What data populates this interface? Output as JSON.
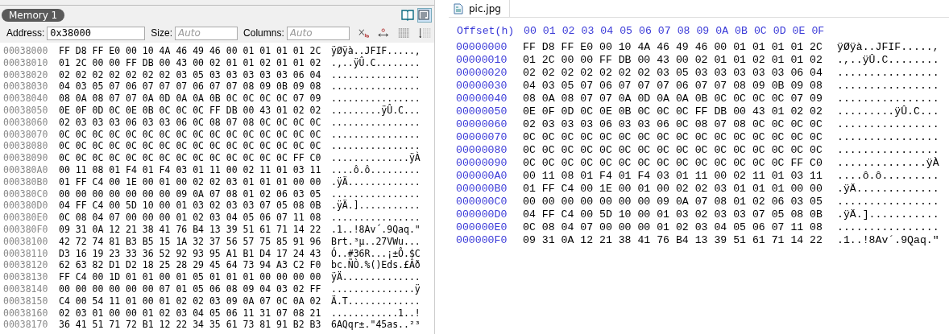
{
  "memory_panel": {
    "tab": "Memory 1",
    "address_label": "Address:",
    "address_value": "0x38000",
    "size_label": "Size:",
    "size_placeholder": "Auto",
    "columns_label": "Columns:",
    "columns_placeholder": "Auto",
    "rows": [
      {
        "address": "00038000",
        "hex": "FF D8 FF E0 00 10 4A 46 49 46 00 01 01 01 01 2C",
        "ascii": "ÿØÿà..JFIF.....,"
      },
      {
        "address": "00038010",
        "hex": "01 2C 00 00 FF DB 00 43 00 02 01 01 02 01 01 02",
        "ascii": ".,..ÿÛ.C........"
      },
      {
        "address": "00038020",
        "hex": "02 02 02 02 02 02 02 03 05 03 03 03 03 03 06 04",
        "ascii": "................"
      },
      {
        "address": "00038030",
        "hex": "04 03 05 07 06 07 07 07 06 07 07 08 09 0B 09 08",
        "ascii": "................"
      },
      {
        "address": "00038040",
        "hex": "08 0A 08 07 07 0A 0D 0A 0A 0B 0C 0C 0C 0C 07 09",
        "ascii": "................"
      },
      {
        "address": "00038050",
        "hex": "0E 0F 0D 0C 0E 0B 0C 0C 0C FF DB 00 43 01 02 02",
        "ascii": ".........ÿÛ.C..."
      },
      {
        "address": "00038060",
        "hex": "02 03 03 03 06 03 03 06 0C 08 07 08 0C 0C 0C 0C",
        "ascii": "................"
      },
      {
        "address": "00038070",
        "hex": "0C 0C 0C 0C 0C 0C 0C 0C 0C 0C 0C 0C 0C 0C 0C 0C",
        "ascii": "................"
      },
      {
        "address": "00038080",
        "hex": "0C 0C 0C 0C 0C 0C 0C 0C 0C 0C 0C 0C 0C 0C 0C 0C",
        "ascii": "................"
      },
      {
        "address": "00038090",
        "hex": "0C 0C 0C 0C 0C 0C 0C 0C 0C 0C 0C 0C 0C 0C FF C0",
        "ascii": "..............ÿÀ"
      },
      {
        "address": "000380A0",
        "hex": "00 11 08 01 F4 01 F4 03 01 11 00 02 11 01 03 11",
        "ascii": "....ô.ô........."
      },
      {
        "address": "000380B0",
        "hex": "01 FF C4 00 1E 00 01 00 02 02 03 01 01 01 00 00",
        "ascii": ".ÿÄ............."
      },
      {
        "address": "000380C0",
        "hex": "00 00 00 00 00 00 00 09 0A 07 08 01 02 06 03 05",
        "ascii": "................"
      },
      {
        "address": "000380D0",
        "hex": "04 FF C4 00 5D 10 00 01 03 02 03 03 07 05 08 0B",
        "ascii": ".ÿÄ.]..........."
      },
      {
        "address": "000380E0",
        "hex": "0C 08 04 07 00 00 00 01 02 03 04 05 06 07 11 08",
        "ascii": "................"
      },
      {
        "address": "000380F0",
        "hex": "09 31 0A 12 21 38 41 76 B4 13 39 51 61 71 14 22",
        "ascii": ".1..!8Av´.9Qaq.\""
      },
      {
        "address": "00038100",
        "hex": "42 72 74 81 B3 B5 15 1A 32 37 56 57 75 85 91 96",
        "ascii": "Brt.³µ..27VWu..."
      },
      {
        "address": "00038110",
        "hex": "D3 16 19 23 33 36 52 92 93 95 A1 B1 D4 17 24 43",
        "ascii": "Ó..#36R...¡±Ô.$C"
      },
      {
        "address": "00038120",
        "hex": "62 63 82 D1 D2 18 25 28 29 45 64 73 94 A3 C2 F0",
        "ascii": "bc.ÑÒ.%()Eds.£Âð"
      },
      {
        "address": "00038130",
        "hex": "FF C4 00 1D 01 01 00 01 05 01 01 01 00 00 00 00",
        "ascii": "ÿÄ.............."
      },
      {
        "address": "00038140",
        "hex": "00 00 00 00 00 00 07 01 05 06 08 09 04 03 02 FF",
        "ascii": "...............ÿ"
      },
      {
        "address": "00038150",
        "hex": "C4 00 54 11 01 00 01 02 02 03 09 0A 07 0C 0A 02",
        "ascii": "Ä.T............."
      },
      {
        "address": "00038160",
        "hex": "02 03 01 00 00 01 02 03 04 05 06 11 31 07 08 21",
        "ascii": "............1..!"
      },
      {
        "address": "00038170",
        "hex": "36 41 51 71 72 B1 12 22 34 35 61 73 81 91 B2 B3",
        "ascii": "6AQqr±.\"45as..²³"
      }
    ]
  },
  "file_panel": {
    "tab": "pic.jpg",
    "offset_header": "Offset(h)",
    "columns": [
      "00",
      "01",
      "02",
      "03",
      "04",
      "05",
      "06",
      "07",
      "08",
      "09",
      "0A",
      "0B",
      "0C",
      "0D",
      "0E",
      "0F"
    ],
    "rows": [
      {
        "address": "00000000",
        "hex": "FF D8 FF E0 00 10 4A 46 49 46 00 01 01 01 01 2C",
        "ascii": "ÿØÿà..JFIF.....,"
      },
      {
        "address": "00000010",
        "hex": "01 2C 00 00 FF DB 00 43 00 02 01 01 02 01 01 02",
        "ascii": ".,..ÿÛ.C........"
      },
      {
        "address": "00000020",
        "hex": "02 02 02 02 02 02 02 03 05 03 03 03 03 03 06 04",
        "ascii": "................"
      },
      {
        "address": "00000030",
        "hex": "04 03 05 07 06 07 07 07 06 07 07 08 09 0B 09 08",
        "ascii": "................"
      },
      {
        "address": "00000040",
        "hex": "08 0A 08 07 07 0A 0D 0A 0A 0B 0C 0C 0C 0C 07 09",
        "ascii": "................"
      },
      {
        "address": "00000050",
        "hex": "0E 0F 0D 0C 0E 0B 0C 0C 0C FF DB 00 43 01 02 02",
        "ascii": ".........ÿÛ.C..."
      },
      {
        "address": "00000060",
        "hex": "02 03 03 03 06 03 03 06 0C 08 07 08 0C 0C 0C 0C",
        "ascii": "................"
      },
      {
        "address": "00000070",
        "hex": "0C 0C 0C 0C 0C 0C 0C 0C 0C 0C 0C 0C 0C 0C 0C 0C",
        "ascii": "................"
      },
      {
        "address": "00000080",
        "hex": "0C 0C 0C 0C 0C 0C 0C 0C 0C 0C 0C 0C 0C 0C 0C 0C",
        "ascii": "................"
      },
      {
        "address": "00000090",
        "hex": "0C 0C 0C 0C 0C 0C 0C 0C 0C 0C 0C 0C 0C 0C FF C0",
        "ascii": "..............ÿÀ"
      },
      {
        "address": "000000A0",
        "hex": "00 11 08 01 F4 01 F4 03 01 11 00 02 11 01 03 11",
        "ascii": "....ô.ô........."
      },
      {
        "address": "000000B0",
        "hex": "01 FF C4 00 1E 00 01 00 02 02 03 01 01 01 00 00",
        "ascii": ".ÿÄ............."
      },
      {
        "address": "000000C0",
        "hex": "00 00 00 00 00 00 00 09 0A 07 08 01 02 06 03 05",
        "ascii": "................"
      },
      {
        "address": "000000D0",
        "hex": "04 FF C4 00 5D 10 00 01 03 02 03 03 07 05 08 0B",
        "ascii": ".ÿÄ.]..........."
      },
      {
        "address": "000000E0",
        "hex": "0C 08 04 07 00 00 00 01 02 03 04 05 06 07 11 08",
        "ascii": "................"
      },
      {
        "address": "000000F0",
        "hex": "09 31 0A 12 21 38 41 76 B4 13 39 51 61 71 14 22",
        "ascii": ".1..!8Av´.9Qaq.\""
      }
    ]
  }
}
